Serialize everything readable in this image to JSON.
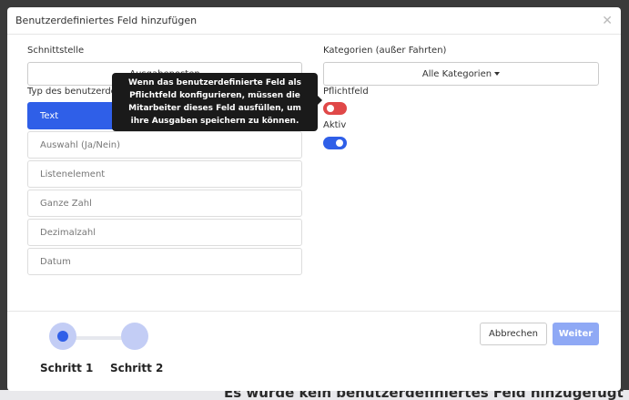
{
  "modal": {
    "title": "Benutzerdefiniertes Feld hinzufügen",
    "close_icon": "close-icon"
  },
  "form": {
    "interface_label": "Schnittstelle",
    "interface_value": "Ausgabeposten",
    "type_label": "Typ des benutzerdefinierten Feldes",
    "types": [
      "Text",
      "Auswahl (Ja/Nein)",
      "Listenelement",
      "Ganze Zahl",
      "Dezimalzahl",
      "Datum"
    ],
    "selected_type": "Text",
    "categories_label": "Kategorien (außer Fahrten)",
    "categories_value": "Alle Kategorien",
    "required_label": "Pflichtfeld",
    "required_on": false,
    "active_label": "Aktiv",
    "active_on": true
  },
  "tooltip": {
    "text": "Wenn das benutzerdefinierte Feld als Pflichtfeld konfigurieren, müssen die Mitarbeiter dieses Feld ausfüllen, um ihre Ausgaben speichern zu können."
  },
  "steps": {
    "step1_label": "Schritt 1",
    "step2_label": "Schritt 2",
    "current_step": 1
  },
  "buttons": {
    "cancel": "Abbrechen",
    "next": "Weiter"
  },
  "background": {
    "empty_message": "Es wurde kein benutzerdefiniertes Feld hinzugefügt"
  },
  "colors": {
    "primary": "#2f5fe8",
    "toggle_off": "#e04848",
    "toggle_on": "#2f5fe8",
    "next_button": "#8fa9f5",
    "step_inactive": "#c3cdf5"
  }
}
